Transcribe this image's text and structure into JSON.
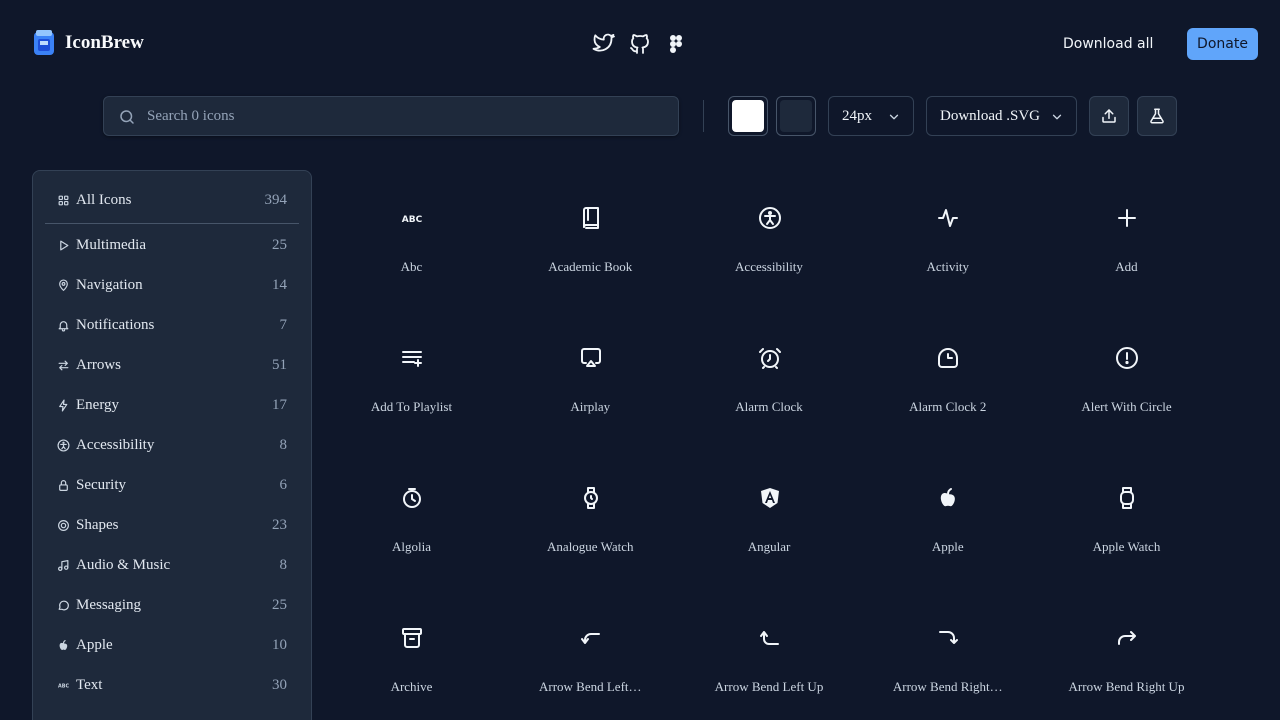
{
  "brand": {
    "name": "IconBrew"
  },
  "header": {
    "download_all": "Download all",
    "donate": "Donate"
  },
  "search": {
    "placeholder": "Search 0 icons"
  },
  "toolbar": {
    "size_label": "24px",
    "download_label": "Download .SVG",
    "color_primary": "#ffffff",
    "color_secondary": "#1e293b"
  },
  "sidebar": {
    "items": [
      {
        "label": "All Icons",
        "count": "394",
        "icon": "grid-icon"
      },
      {
        "label": "Multimedia",
        "count": "25",
        "icon": "play-icon"
      },
      {
        "label": "Navigation",
        "count": "14",
        "icon": "map-pin-icon"
      },
      {
        "label": "Notifications",
        "count": "7",
        "icon": "bell-icon"
      },
      {
        "label": "Arrows",
        "count": "51",
        "icon": "arrows-icon"
      },
      {
        "label": "Energy",
        "count": "17",
        "icon": "bolt-icon"
      },
      {
        "label": "Accessibility",
        "count": "8",
        "icon": "accessibility-icon"
      },
      {
        "label": "Security",
        "count": "6",
        "icon": "lock-icon"
      },
      {
        "label": "Shapes",
        "count": "23",
        "icon": "shapes-icon"
      },
      {
        "label": "Audio & Music",
        "count": "8",
        "icon": "music-icon"
      },
      {
        "label": "Messaging",
        "count": "25",
        "icon": "message-icon"
      },
      {
        "label": "Apple",
        "count": "10",
        "icon": "apple-icon"
      },
      {
        "label": "Text",
        "count": "30",
        "icon": "abc-icon"
      }
    ]
  },
  "icons": [
    {
      "label": "Abc",
      "icon": "abc-icon"
    },
    {
      "label": "Academic Book",
      "icon": "book-icon"
    },
    {
      "label": "Accessibility",
      "icon": "accessibility-icon"
    },
    {
      "label": "Activity",
      "icon": "activity-icon"
    },
    {
      "label": "Add",
      "icon": "plus-icon"
    },
    {
      "label": "Add To Playlist",
      "icon": "playlist-add-icon"
    },
    {
      "label": "Airplay",
      "icon": "airplay-icon"
    },
    {
      "label": "Alarm Clock",
      "icon": "alarm-clock-icon"
    },
    {
      "label": "Alarm Clock 2",
      "icon": "alarm-clock-2-icon"
    },
    {
      "label": "Alert With Circle",
      "icon": "alert-circle-icon"
    },
    {
      "label": "Algolia",
      "icon": "algolia-icon"
    },
    {
      "label": "Analogue Watch",
      "icon": "watch-icon"
    },
    {
      "label": "Angular",
      "icon": "angular-icon"
    },
    {
      "label": "Apple",
      "icon": "apple-icon"
    },
    {
      "label": "Apple Watch",
      "icon": "apple-watch-icon"
    },
    {
      "label": "Archive",
      "icon": "archive-icon"
    },
    {
      "label": "Arrow Bend Left…",
      "icon": "arrow-bend-left-down-icon"
    },
    {
      "label": "Arrow Bend Left Up",
      "icon": "arrow-bend-left-up-icon"
    },
    {
      "label": "Arrow Bend Right…",
      "icon": "arrow-bend-right-down-icon"
    },
    {
      "label": "Arrow Bend Right Up",
      "icon": "arrow-bend-right-up-icon"
    }
  ]
}
